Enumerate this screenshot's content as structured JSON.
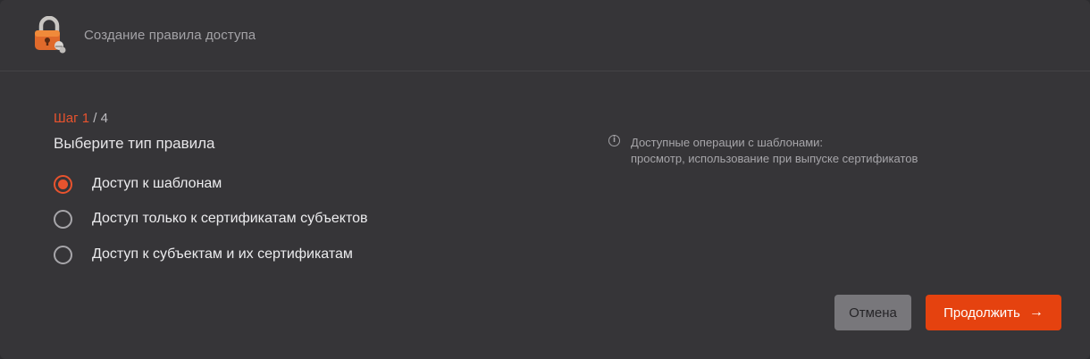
{
  "dialog": {
    "title": "Создание правила доступа"
  },
  "step": {
    "current": "Шаг 1",
    "total": " / 4"
  },
  "heading": "Выберите тип правила",
  "options": [
    {
      "label": "Доступ к шаблонам",
      "checked": true
    },
    {
      "label": "Доступ только к сертификатам субъектов",
      "checked": false
    },
    {
      "label": "Доступ к субъектам и их сертификатам",
      "checked": false
    }
  ],
  "info": {
    "icon": "i",
    "line1": "Доступные операции с шаблонами:",
    "line2": "просмотр, использование при выпуске сертификатов"
  },
  "buttons": {
    "cancel": "Отмена",
    "continue": "Продолжить",
    "continue_icon": "→"
  },
  "colors": {
    "accent": "#e8532e",
    "primary_button": "#e5420f",
    "background": "#363538"
  }
}
